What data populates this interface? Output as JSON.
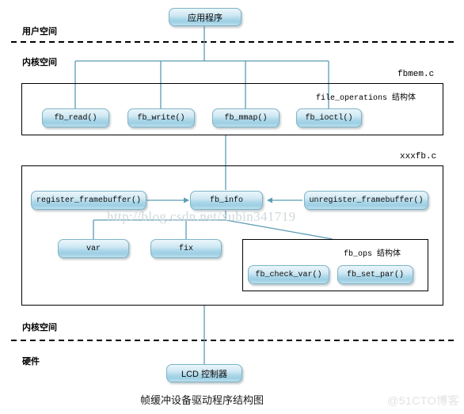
{
  "diagram": {
    "caption": "帧缓冲设备驱动程序结构图",
    "watermark_url": "http://blog.csdn.net/xubin341719",
    "watermark_site": "@51CTO博客",
    "line_color": "#5b9cb5",
    "node_border_color": "#7fb4c6",
    "frame_border_color": "#000000"
  },
  "layers": {
    "user_space": "用户空间",
    "kernel_space_top": "内核空间",
    "kernel_space_bottom": "内核空间",
    "hardware": "硬件"
  },
  "files": {
    "fbmem": "fbmem.c",
    "xxxfb": "xxxfb.c"
  },
  "structs": {
    "file_operations": "file_operations 结构体",
    "fb_ops": "fb_ops 结构体"
  },
  "nodes": {
    "app": "应用程序",
    "fb_read": "fb_read()",
    "fb_write": "fb_write()",
    "fb_mmap": "fb_mmap()",
    "fb_ioctl": "fb_ioctl()",
    "register_framebuffer": "register_framebuffer()",
    "fb_info": "fb_info",
    "unregister_framebuffer": "unregister_framebuffer()",
    "var": "var",
    "fix": "fix",
    "fb_check_var": "fb_check_var()",
    "fb_set_par": "fb_set_par()",
    "lcd_controller": "LCD 控制器"
  }
}
